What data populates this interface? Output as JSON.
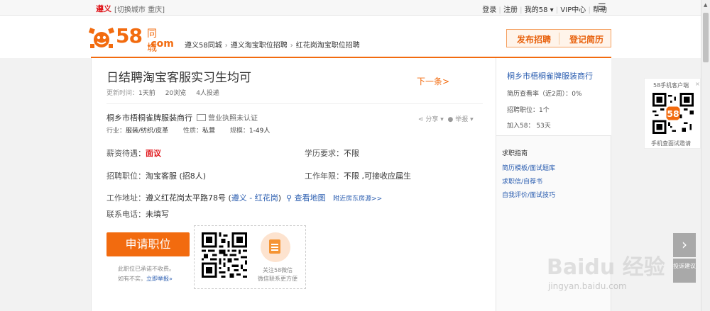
{
  "topbar": {
    "city": "遵义",
    "switch": "[切换城市  重庆]",
    "links": [
      "登录",
      "注册",
      "我的58 ▾",
      "VIP中心",
      "帮助"
    ],
    "menu_icon": "menu-icon"
  },
  "header": {
    "logo_num": "58",
    "logo_tc": "同城",
    "logo_com": ".com",
    "breadcrumb": [
      "遵义58同城",
      "遵义淘宝职位招聘",
      "红花岗淘宝职位招聘"
    ],
    "post_job": "发布招聘",
    "register_resume": "登记简历",
    "accent": "#f26b0f"
  },
  "job": {
    "title": "日结聘淘宝客服实习生均可",
    "next": "下一条>",
    "update_label": "更新时间：",
    "update_value": "1天前",
    "views": "20浏览",
    "applies": "4人投递",
    "company": "桐乡市梧桐雀牌服装商行",
    "license": "营业执照未认证",
    "share": "分享 ▾",
    "report": "举报 ▾",
    "industry_label": "行业：",
    "industry": "服装/纺织/皮革",
    "nature_label": "性质：",
    "nature": "私营",
    "scale_label": "规模：",
    "scale": "1-49人",
    "salary_label": "薪资待遇：",
    "salary": "面议",
    "edu_label": "学历要求：",
    "edu": "不限",
    "position_label": "招聘职位：",
    "position": "淘宝客服 (招8人)",
    "exp_label": "工作年限：",
    "exp": "不限 ,可接收应届生",
    "address_label": "工作地址：",
    "address": "遵义红花岗太平路78号 (",
    "address_area": "遵义 - 红花岗",
    "address_close": ")",
    "map": "查看地图",
    "nearby": "附近房东房源>>",
    "phone_label": "联系电话：",
    "phone": "未填写",
    "apply_button": "申请职位",
    "note1": "此职位已承诺不收费。",
    "note2_pre": "如有不实，",
    "note2_link": "立即举报»",
    "wechat1": "关注58微信",
    "wechat2": "微信联系更方便"
  },
  "sidebar": {
    "company": "桐乡市梧桐雀牌服装商行",
    "resume_rate": "简历查看率（近2周）：0%",
    "jobs": "招聘职位：1个",
    "joined": "加入58：  53天",
    "guide_title": "求职指南",
    "guides": [
      "简历模板/面试题库",
      "求职信/自荐书",
      "自我评价/面试技巧"
    ]
  },
  "float": {
    "app_title": "58手机客户端",
    "app_close": "×",
    "app_bottom": "手机查面试邀请",
    "arrow": "›",
    "feedback": "投诉建议"
  },
  "watermark": {
    "main": "Baidu 经验",
    "sub": "jingyan.baidu.com"
  }
}
